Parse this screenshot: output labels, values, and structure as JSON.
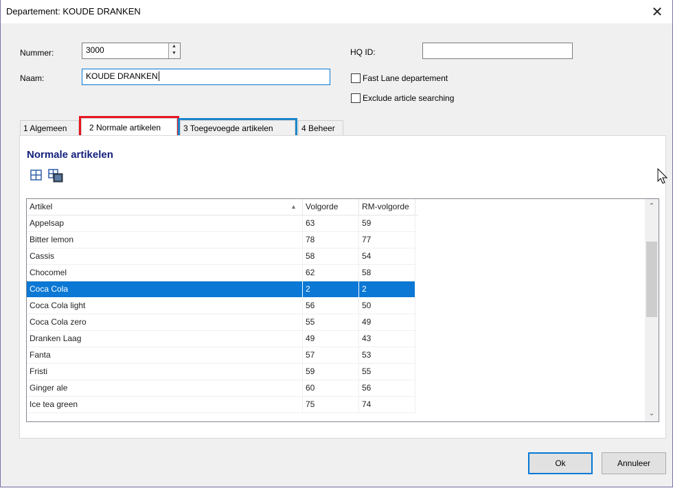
{
  "window": {
    "title": "Departement: KOUDE DRANKEN",
    "close_glyph": "✕"
  },
  "form": {
    "nummer_label": "Nummer:",
    "nummer_value": "3000",
    "naam_label": "Naam:",
    "naam_value": "KOUDE DRANKEN",
    "hqid_label": "HQ ID:",
    "hqid_value": "",
    "fast_lane_label": "Fast Lane departement",
    "exclude_label": "Exclude article searching"
  },
  "tabs": [
    {
      "label": "1 Algemeen"
    },
    {
      "label": "2 Normale artikelen"
    },
    {
      "label": "3 Toegevoegde artikelen"
    },
    {
      "label": "4 Beheer"
    }
  ],
  "section": {
    "title": "Normale artikelen"
  },
  "grid": {
    "columns": [
      "Artikel",
      "Volgorde",
      "RM-volgorde"
    ],
    "rows": [
      {
        "artikel": "Appelsap",
        "volgorde": "63",
        "rm": "59"
      },
      {
        "artikel": "Bitter lemon",
        "volgorde": "78",
        "rm": "77"
      },
      {
        "artikel": "Cassis",
        "volgorde": "58",
        "rm": "54"
      },
      {
        "artikel": "Chocomel",
        "volgorde": "62",
        "rm": "58"
      },
      {
        "artikel": "Coca Cola",
        "volgorde": "2",
        "rm": "2"
      },
      {
        "artikel": "Coca Cola light",
        "volgorde": "56",
        "rm": "50"
      },
      {
        "artikel": "Coca Cola zero",
        "volgorde": "55",
        "rm": "49"
      },
      {
        "artikel": "Dranken Laag",
        "volgorde": "49",
        "rm": "43"
      },
      {
        "artikel": "Fanta",
        "volgorde": "57",
        "rm": "53"
      },
      {
        "artikel": "Fristi",
        "volgorde": "59",
        "rm": "55"
      },
      {
        "artikel": "Ginger ale",
        "volgorde": "60",
        "rm": "56"
      },
      {
        "artikel": "Ice tea green",
        "volgorde": "75",
        "rm": "74"
      }
    ],
    "selected_index": 4
  },
  "buttons": {
    "ok": "Ok",
    "cancel": "Annuleer"
  },
  "colors": {
    "selection": "#0a78d4",
    "section_title": "#13207b",
    "highlight_red": "#e8141e",
    "highlight_blue": "#1b86c9"
  }
}
